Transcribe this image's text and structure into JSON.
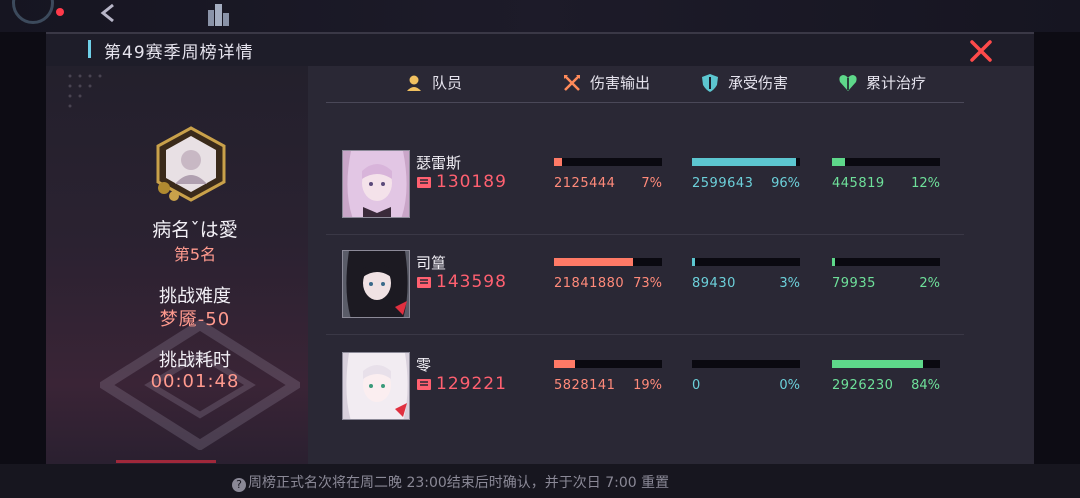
{
  "panel": {
    "title": "第49赛季周榜详情"
  },
  "player": {
    "name": "病名ˇは愛",
    "rank": "第5名",
    "difficulty_label": "挑战难度",
    "difficulty_value": "梦魇-50",
    "time_label": "挑战耗时",
    "time_value": "00:01:48"
  },
  "headers": {
    "member": "队员",
    "damage": "伤害输出",
    "taken": "承受伤害",
    "heal": "累计治疗"
  },
  "colors": {
    "damage": "#ff7a66",
    "taken": "#5cc6d0",
    "heal": "#5ed88a",
    "accent_red": "#ff6070"
  },
  "members": [
    {
      "name": "瑟雷斯",
      "power": "130189",
      "damage": {
        "value": "2125444",
        "pct": "7%",
        "fraction": 0.07
      },
      "taken": {
        "value": "2599643",
        "pct": "96%",
        "fraction": 0.96
      },
      "heal": {
        "value": "445819",
        "pct": "12%",
        "fraction": 0.12
      }
    },
    {
      "name": "司篁",
      "power": "143598",
      "damage": {
        "value": "21841880",
        "pct": "73%",
        "fraction": 0.73
      },
      "taken": {
        "value": "89430",
        "pct": "3%",
        "fraction": 0.03
      },
      "heal": {
        "value": "79935",
        "pct": "2%",
        "fraction": 0.02
      }
    },
    {
      "name": "零",
      "power": "129221",
      "damage": {
        "value": "5828141",
        "pct": "19%",
        "fraction": 0.19
      },
      "taken": {
        "value": "0",
        "pct": "0%",
        "fraction": 0.0
      },
      "heal": {
        "value": "2926230",
        "pct": "84%",
        "fraction": 0.84
      }
    }
  ],
  "footer": {
    "text": "周榜正式名次将在周二晚 23:00结束后时确认，并于次日 7:00 重置"
  }
}
